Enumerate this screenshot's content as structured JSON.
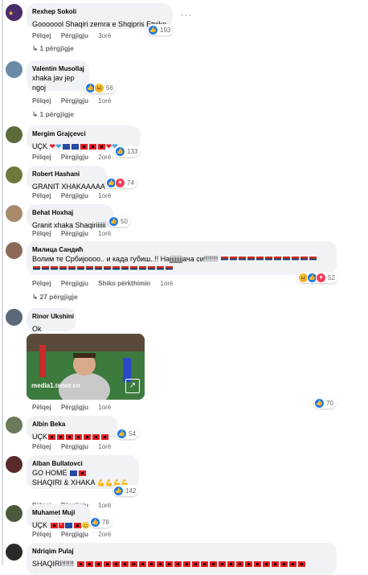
{
  "actions": {
    "like": "Pëlqej",
    "reply": "Përgjigju",
    "see_translation": "Shiko përkthimin"
  },
  "comments": [
    {
      "name": "Rexhep Sokoli",
      "text": "Gooooool Shaqiri zemra e Shqipris Etnike .",
      "time": "3orë",
      "reactions": "193",
      "replies": "1 përgjigje"
    },
    {
      "name": "Valentin Musollaj",
      "text1": "xhaka jav jep",
      "text2": "ngoj",
      "time": "1orë",
      "reactions": "56",
      "replies": "1 përgjigje"
    },
    {
      "name": "Mergim Grajçevci",
      "text": "UÇK",
      "time": "2orë",
      "reactions": "133"
    },
    {
      "name": "Robert Hashani",
      "text": "GRANIT XHAKAAAAA",
      "time": "1orë",
      "reactions": "74"
    },
    {
      "name": "Behat Hoxhaj",
      "text": "Granit xhaka Shaqiriiiiii",
      "time": "1orë",
      "reactions": "50"
    },
    {
      "name": "Милица Сандић",
      "text": "Волим те Србијоооо.. и када губиш..!! Најјјјјјјјача си!!!!!!!",
      "time": "1orë",
      "reactions": "52",
      "replies": "27 përgjigje"
    },
    {
      "name": "Rinor Ukshini",
      "text": "Ok",
      "gif_source": "media1.tenor.co",
      "time": "1orë",
      "reactions": "70"
    },
    {
      "name": "Albin Beka",
      "text": "UÇK",
      "time": "1orë",
      "reactions": "54"
    },
    {
      "name": "Alban Bullatovci",
      "text1": "GO HOME",
      "text2": "SHAQIRI & XHAKA",
      "time": "1orë",
      "reactions": "142"
    },
    {
      "name": "Muhamet Muji",
      "text": "UÇK",
      "time": "2orë",
      "reactions": "78"
    },
    {
      "name": "Ndriqim Pulaj",
      "text": "SHAQIRI!!!!!!"
    }
  ]
}
